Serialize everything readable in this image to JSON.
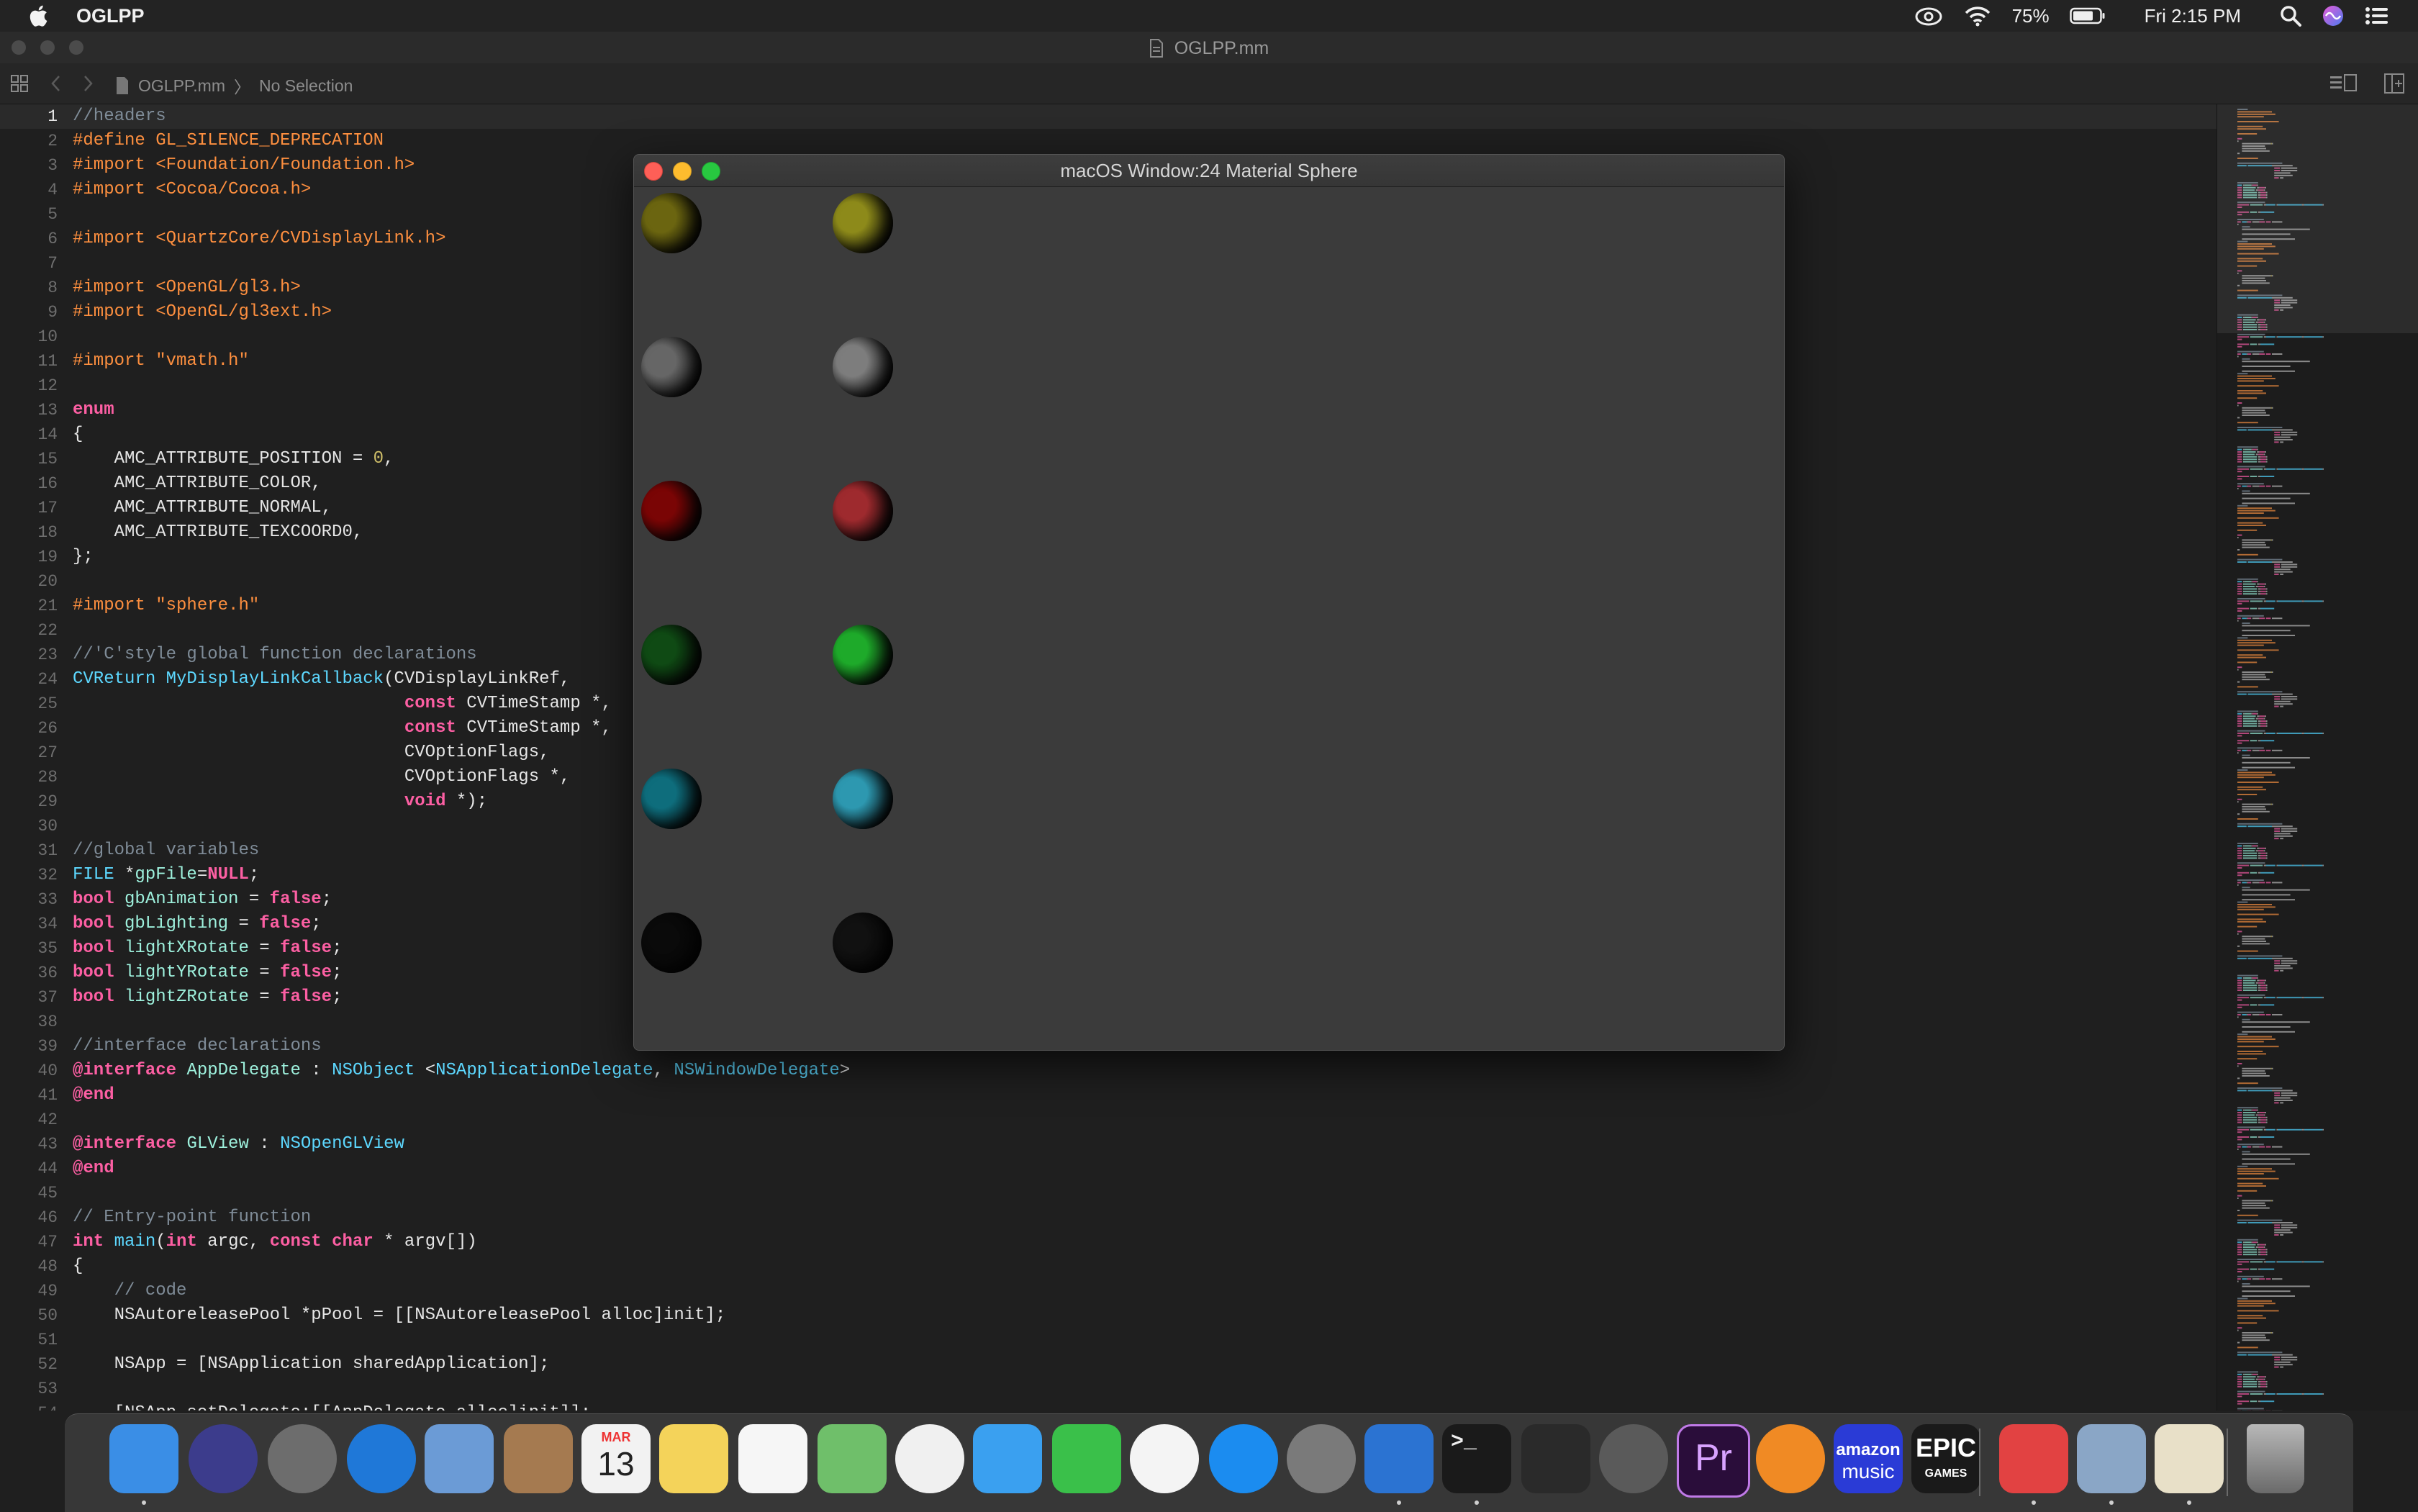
{
  "menubar": {
    "app_name": "OGLPP",
    "battery_percent": "75%",
    "datetime": "Fri 2:15 PM"
  },
  "window": {
    "title": "OGLPP.mm"
  },
  "jumpbar": {
    "file": "OGLPP.mm",
    "selection": "No Selection"
  },
  "editor": {
    "current_line": 1,
    "lines": [
      [
        [
          "c-comment",
          "//headers"
        ]
      ],
      [
        [
          "c-pre",
          "#define GL_SILENCE_DEPRECATION"
        ]
      ],
      [
        [
          "c-pre",
          "#import <Foundation/Foundation.h>"
        ]
      ],
      [
        [
          "c-pre",
          "#import <Cocoa/Cocoa.h>"
        ]
      ],
      [],
      [
        [
          "c-pre",
          "#import <QuartzCore/CVDisplayLink.h>"
        ]
      ],
      [],
      [
        [
          "c-pre",
          "#import <OpenGL/gl3.h>"
        ]
      ],
      [
        [
          "c-pre",
          "#import <OpenGL/gl3ext.h>"
        ]
      ],
      [],
      [
        [
          "c-pre",
          "#import \"vmath.h\""
        ]
      ],
      [],
      [
        [
          "c-kw",
          "enum"
        ]
      ],
      [
        [
          "c-plain",
          "{"
        ]
      ],
      [
        [
          "c-plain",
          "    AMC_ATTRIBUTE_POSITION = "
        ],
        [
          "c-num",
          "0"
        ],
        [
          "c-plain",
          ","
        ]
      ],
      [
        [
          "c-plain",
          "    AMC_ATTRIBUTE_COLOR,"
        ]
      ],
      [
        [
          "c-plain",
          "    AMC_ATTRIBUTE_NORMAL,"
        ]
      ],
      [
        [
          "c-plain",
          "    AMC_ATTRIBUTE_TEXCOORD0,"
        ]
      ],
      [
        [
          "c-plain",
          "};"
        ]
      ],
      [],
      [
        [
          "c-pre",
          "#import \"sphere.h\""
        ]
      ],
      [],
      [
        [
          "c-comment",
          "//'C'style global function declarations"
        ]
      ],
      [
        [
          "c-type",
          "CVReturn"
        ],
        [
          "c-plain",
          " "
        ],
        [
          "c-type",
          "MyDisplayLinkCallback"
        ],
        [
          "c-plain",
          "(CVDisplayLinkRef,"
        ]
      ],
      [
        [
          "c-plain",
          "                                "
        ],
        [
          "c-kw",
          "const"
        ],
        [
          "c-plain",
          " CVTimeStamp *,"
        ]
      ],
      [
        [
          "c-plain",
          "                                "
        ],
        [
          "c-kw",
          "const"
        ],
        [
          "c-plain",
          " CVTimeStamp *,"
        ]
      ],
      [
        [
          "c-plain",
          "                                CVOptionFlags,"
        ]
      ],
      [
        [
          "c-plain",
          "                                CVOptionFlags *,"
        ]
      ],
      [
        [
          "c-plain",
          "                                "
        ],
        [
          "c-kw",
          "void"
        ],
        [
          "c-plain",
          " *);"
        ]
      ],
      [],
      [
        [
          "c-comment",
          "//global variables"
        ]
      ],
      [
        [
          "c-type",
          "FILE"
        ],
        [
          "c-plain",
          " *"
        ],
        [
          "c-proj",
          "gpFile"
        ],
        [
          "c-plain",
          "="
        ],
        [
          "c-kw",
          "NULL"
        ],
        [
          "c-plain",
          ";"
        ]
      ],
      [
        [
          "c-kw",
          "bool"
        ],
        [
          "c-plain",
          " "
        ],
        [
          "c-proj",
          "gbAnimation"
        ],
        [
          "c-plain",
          " = "
        ],
        [
          "c-kw",
          "false"
        ],
        [
          "c-plain",
          ";"
        ]
      ],
      [
        [
          "c-kw",
          "bool"
        ],
        [
          "c-plain",
          " "
        ],
        [
          "c-proj",
          "gbLighting"
        ],
        [
          "c-plain",
          " = "
        ],
        [
          "c-kw",
          "false"
        ],
        [
          "c-plain",
          ";"
        ]
      ],
      [
        [
          "c-kw",
          "bool"
        ],
        [
          "c-plain",
          " "
        ],
        [
          "c-proj",
          "lightXRotate"
        ],
        [
          "c-plain",
          " = "
        ],
        [
          "c-kw",
          "false"
        ],
        [
          "c-plain",
          ";"
        ]
      ],
      [
        [
          "c-kw",
          "bool"
        ],
        [
          "c-plain",
          " "
        ],
        [
          "c-proj",
          "lightYRotate"
        ],
        [
          "c-plain",
          " = "
        ],
        [
          "c-kw",
          "false"
        ],
        [
          "c-plain",
          ";"
        ]
      ],
      [
        [
          "c-kw",
          "bool"
        ],
        [
          "c-plain",
          " "
        ],
        [
          "c-proj",
          "lightZRotate"
        ],
        [
          "c-plain",
          " = "
        ],
        [
          "c-kw",
          "false"
        ],
        [
          "c-plain",
          ";"
        ]
      ],
      [],
      [
        [
          "c-comment",
          "//interface declarations"
        ]
      ],
      [
        [
          "c-kw",
          "@interface"
        ],
        [
          "c-plain",
          " "
        ],
        [
          "c-proj",
          "AppDelegate"
        ],
        [
          "c-plain",
          " : "
        ],
        [
          "c-type",
          "NSObject"
        ],
        [
          "c-plain",
          " <"
        ],
        [
          "c-type",
          "NSApplicationDelegate"
        ],
        [
          "c-plain",
          ", "
        ],
        [
          "c-type",
          "NSWindowDelegate"
        ],
        [
          "c-plain",
          ">"
        ]
      ],
      [
        [
          "c-kw",
          "@end"
        ]
      ],
      [],
      [
        [
          "c-kw",
          "@interface"
        ],
        [
          "c-plain",
          " "
        ],
        [
          "c-proj",
          "GLView"
        ],
        [
          "c-plain",
          " : "
        ],
        [
          "c-type",
          "NSOpenGLView"
        ]
      ],
      [
        [
          "c-kw",
          "@end"
        ]
      ],
      [],
      [
        [
          "c-comment",
          "// Entry-point function"
        ]
      ],
      [
        [
          "c-kw",
          "int"
        ],
        [
          "c-plain",
          " "
        ],
        [
          "c-type",
          "main"
        ],
        [
          "c-plain",
          "("
        ],
        [
          "c-kw",
          "int"
        ],
        [
          "c-plain",
          " argc, "
        ],
        [
          "c-kw",
          "const"
        ],
        [
          "c-plain",
          " "
        ],
        [
          "c-kw",
          "char"
        ],
        [
          "c-plain",
          " * argv[])"
        ]
      ],
      [
        [
          "c-plain",
          "{"
        ]
      ],
      [
        [
          "c-comment",
          "    // code"
        ]
      ],
      [
        [
          "c-plain",
          "    NSAutoreleasePool *pPool = [[NSAutoreleasePool alloc]init];"
        ]
      ],
      [],
      [
        [
          "c-plain",
          "    NSApp = [NSApplication sharedApplication];"
        ]
      ],
      [],
      [
        [
          "c-plain",
          "    [NSApp setDelegate:[[AppDelegate alloc]init]];"
        ]
      ]
    ]
  },
  "glwindow": {
    "title": "macOS Window:24 Material Sphere",
    "rows": 6,
    "cols": 4,
    "spheres": [
      "#3a8f8c",
      "#5a5a5a",
      "#6b6510",
      "#8d8a1a",
      "#8a0b0b",
      "#8a6a1e",
      "#666666",
      "#7d7d7d",
      "#e2c4c4",
      "#a6440f",
      "#7a0505",
      "#9e2a2e",
      "#22203a",
      "#4e4e4e",
      "#0f4a14",
      "#1eaa2a",
      "#7bc597",
      "#9c5a22",
      "#0e6d7c",
      "#2d98b0",
      "#0a7a15",
      "#a97d19",
      "#0a0a0a",
      "#111111"
    ]
  },
  "dock": {
    "apps": [
      {
        "name": "finder",
        "color": "#3a8ee6",
        "dot": true
      },
      {
        "name": "siri",
        "color": "#3c3c8c",
        "dot": false
      },
      {
        "name": "launchpad",
        "color": "#6d6d6d",
        "dot": false
      },
      {
        "name": "safari",
        "color": "#1f78d8",
        "dot": false
      },
      {
        "name": "mail",
        "color": "#6b9bd6",
        "dot": false
      },
      {
        "name": "contacts",
        "color": "#a57a50",
        "dot": false
      },
      {
        "name": "calendar",
        "color": "#f2f2f2",
        "dot": false
      },
      {
        "name": "notes",
        "color": "#f4d35a",
        "dot": false
      },
      {
        "name": "reminders",
        "color": "#f6f6f6",
        "dot": false
      },
      {
        "name": "maps",
        "color": "#6fbf6a",
        "dot": false
      },
      {
        "name": "photos",
        "color": "#f0f0f0",
        "dot": false
      },
      {
        "name": "messages",
        "color": "#3aa0f0",
        "dot": false
      },
      {
        "name": "facetime",
        "color": "#3ac04a",
        "dot": false
      },
      {
        "name": "itunes",
        "color": "#f4f4f4",
        "dot": false
      },
      {
        "name": "app-store",
        "color": "#1b8cf0",
        "dot": false
      },
      {
        "name": "system-preferences",
        "color": "#7a7a7a",
        "dot": false
      },
      {
        "name": "xcode",
        "color": "#2b73d2",
        "dot": true
      },
      {
        "name": "terminal",
        "color": "#1a1a1a",
        "dot": true
      },
      {
        "name": "final-cut-pro",
        "color": "#2a2a2a",
        "dot": false
      },
      {
        "name": "compressor",
        "color": "#5a5a5a",
        "dot": false
      },
      {
        "name": "premiere-pro",
        "color": "#2a0d3a",
        "dot": false
      },
      {
        "name": "firefox",
        "color": "#f08a24",
        "dot": false
      },
      {
        "name": "amazon-music",
        "color": "#2a3bd6",
        "dot": false
      },
      {
        "name": "epic-games",
        "color": "#1a1a1a",
        "dot": false
      },
      {
        "name": "anydesk",
        "color": "#e24242",
        "dot": true
      },
      {
        "name": "preview",
        "color": "#8aa6c6",
        "dot": true
      },
      {
        "name": "textedit",
        "color": "#e8e0c8",
        "dot": true
      },
      {
        "name": "trash",
        "color": "#8a8a8a",
        "dot": false
      }
    ],
    "labels": {
      "calendar_month": "MAR",
      "calendar_day": "13",
      "premiere": "Pr",
      "amazon_top": "amazon",
      "amazon_bottom": "music",
      "epic_top": "EPIC",
      "epic_bottom": "GAMES"
    }
  }
}
